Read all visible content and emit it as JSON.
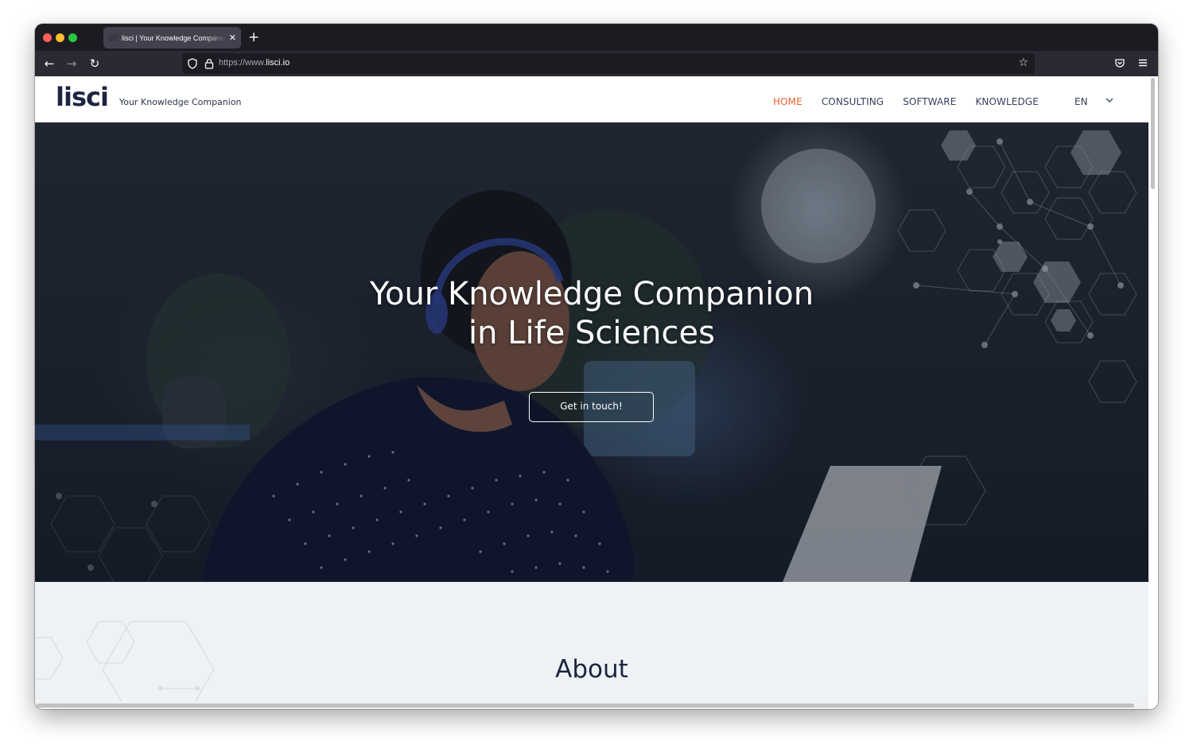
{
  "browser": {
    "tab_title": "lisci | Your Knowledge Companion",
    "url_prefix": "https://www.",
    "url_domain": "lisci.io"
  },
  "site": {
    "logo": "lisci",
    "tagline": "Your Knowledge Companion",
    "nav": [
      {
        "label": "HOME",
        "active": true
      },
      {
        "label": "CONSULTING",
        "active": false
      },
      {
        "label": "SOFTWARE",
        "active": false
      },
      {
        "label": "KNOWLEDGE",
        "active": false
      }
    ],
    "language": "EN"
  },
  "hero": {
    "title_line1": "Your Knowledge Companion",
    "title_line2": "in Life Sciences",
    "cta_label": "Get in touch!"
  },
  "about": {
    "title": "About"
  },
  "colors": {
    "accent": "#e8612c",
    "nav_text": "#34405e",
    "brand_dark": "#1b2540",
    "section_bg": "#eef2f5"
  }
}
